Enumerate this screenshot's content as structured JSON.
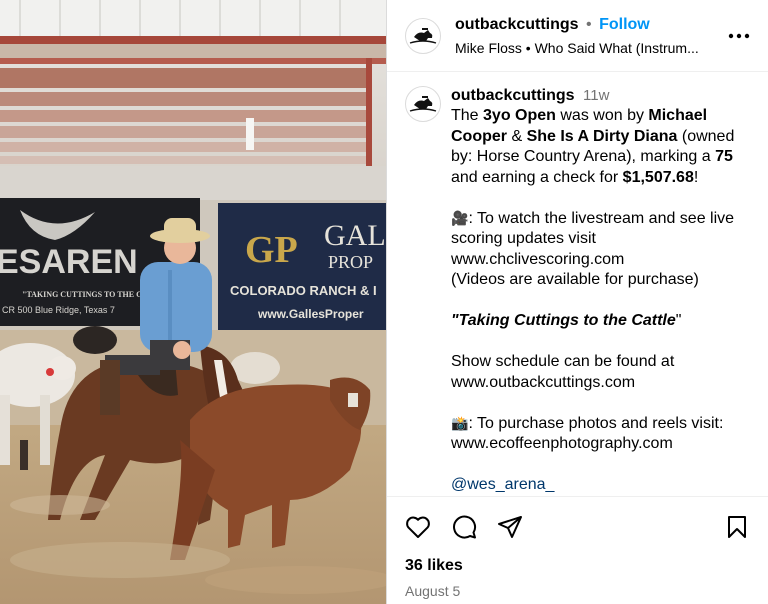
{
  "photo": {
    "banner_left_main": "ESAREN",
    "banner_left_tag": "\"TAKING CUTTINGS TO THE CATTLE\"",
    "banner_left_addr": "CR 500 Blue Ridge, Texas 7",
    "banner_right_logo": "GP",
    "banner_right_main": "GAL",
    "banner_right_sub": "PROP",
    "banner_right_line": "COLORADO RANCH & I",
    "banner_right_url": "www.GallesProper"
  },
  "header": {
    "username": "outbackcuttings",
    "separator": "•",
    "follow_label": "Follow",
    "audio": "Mike Floss • Who Said What (Instrum..."
  },
  "caption": {
    "username": "outbackcuttings",
    "time": "11w",
    "p1_a": "The ",
    "p1_b": "3yo Open",
    "p1_c": " was won by ",
    "p1_d": "Michael Cooper",
    "p1_e": " & ",
    "p1_f": "She Is A Dirty Diana",
    "p1_g": " (owned by: Horse Country Arena), marking a ",
    "p1_h": "75",
    "p1_i": " and earning a check for ",
    "p1_j": "$1,507.68",
    "p1_k": "!",
    "emoji_camera": "🎥",
    "p2": ": To watch the livestream and see live scoring updates visit",
    "p2_url": "www.chclivescoring.com",
    "p2_note": "(Videos are available for purchase)",
    "quote_open": "\"",
    "quote": "Taking Cuttings to the Cattle",
    "quote_close": "\"",
    "p3": "Show schedule can be found at",
    "p3_url": "www.outbackcuttings.com",
    "emoji_photo": "📸",
    "p4": ": To purchase photos and reels visit:",
    "p4_url": "www.ecoffeenphotography.com",
    "mention": "@wes_arena_"
  },
  "footer": {
    "likes": "36 likes",
    "date": "August 5"
  },
  "icons": {
    "heart": "heart-icon",
    "comment": "comment-icon",
    "share": "share-icon",
    "save": "bookmark-icon",
    "more": "more-options-icon"
  }
}
